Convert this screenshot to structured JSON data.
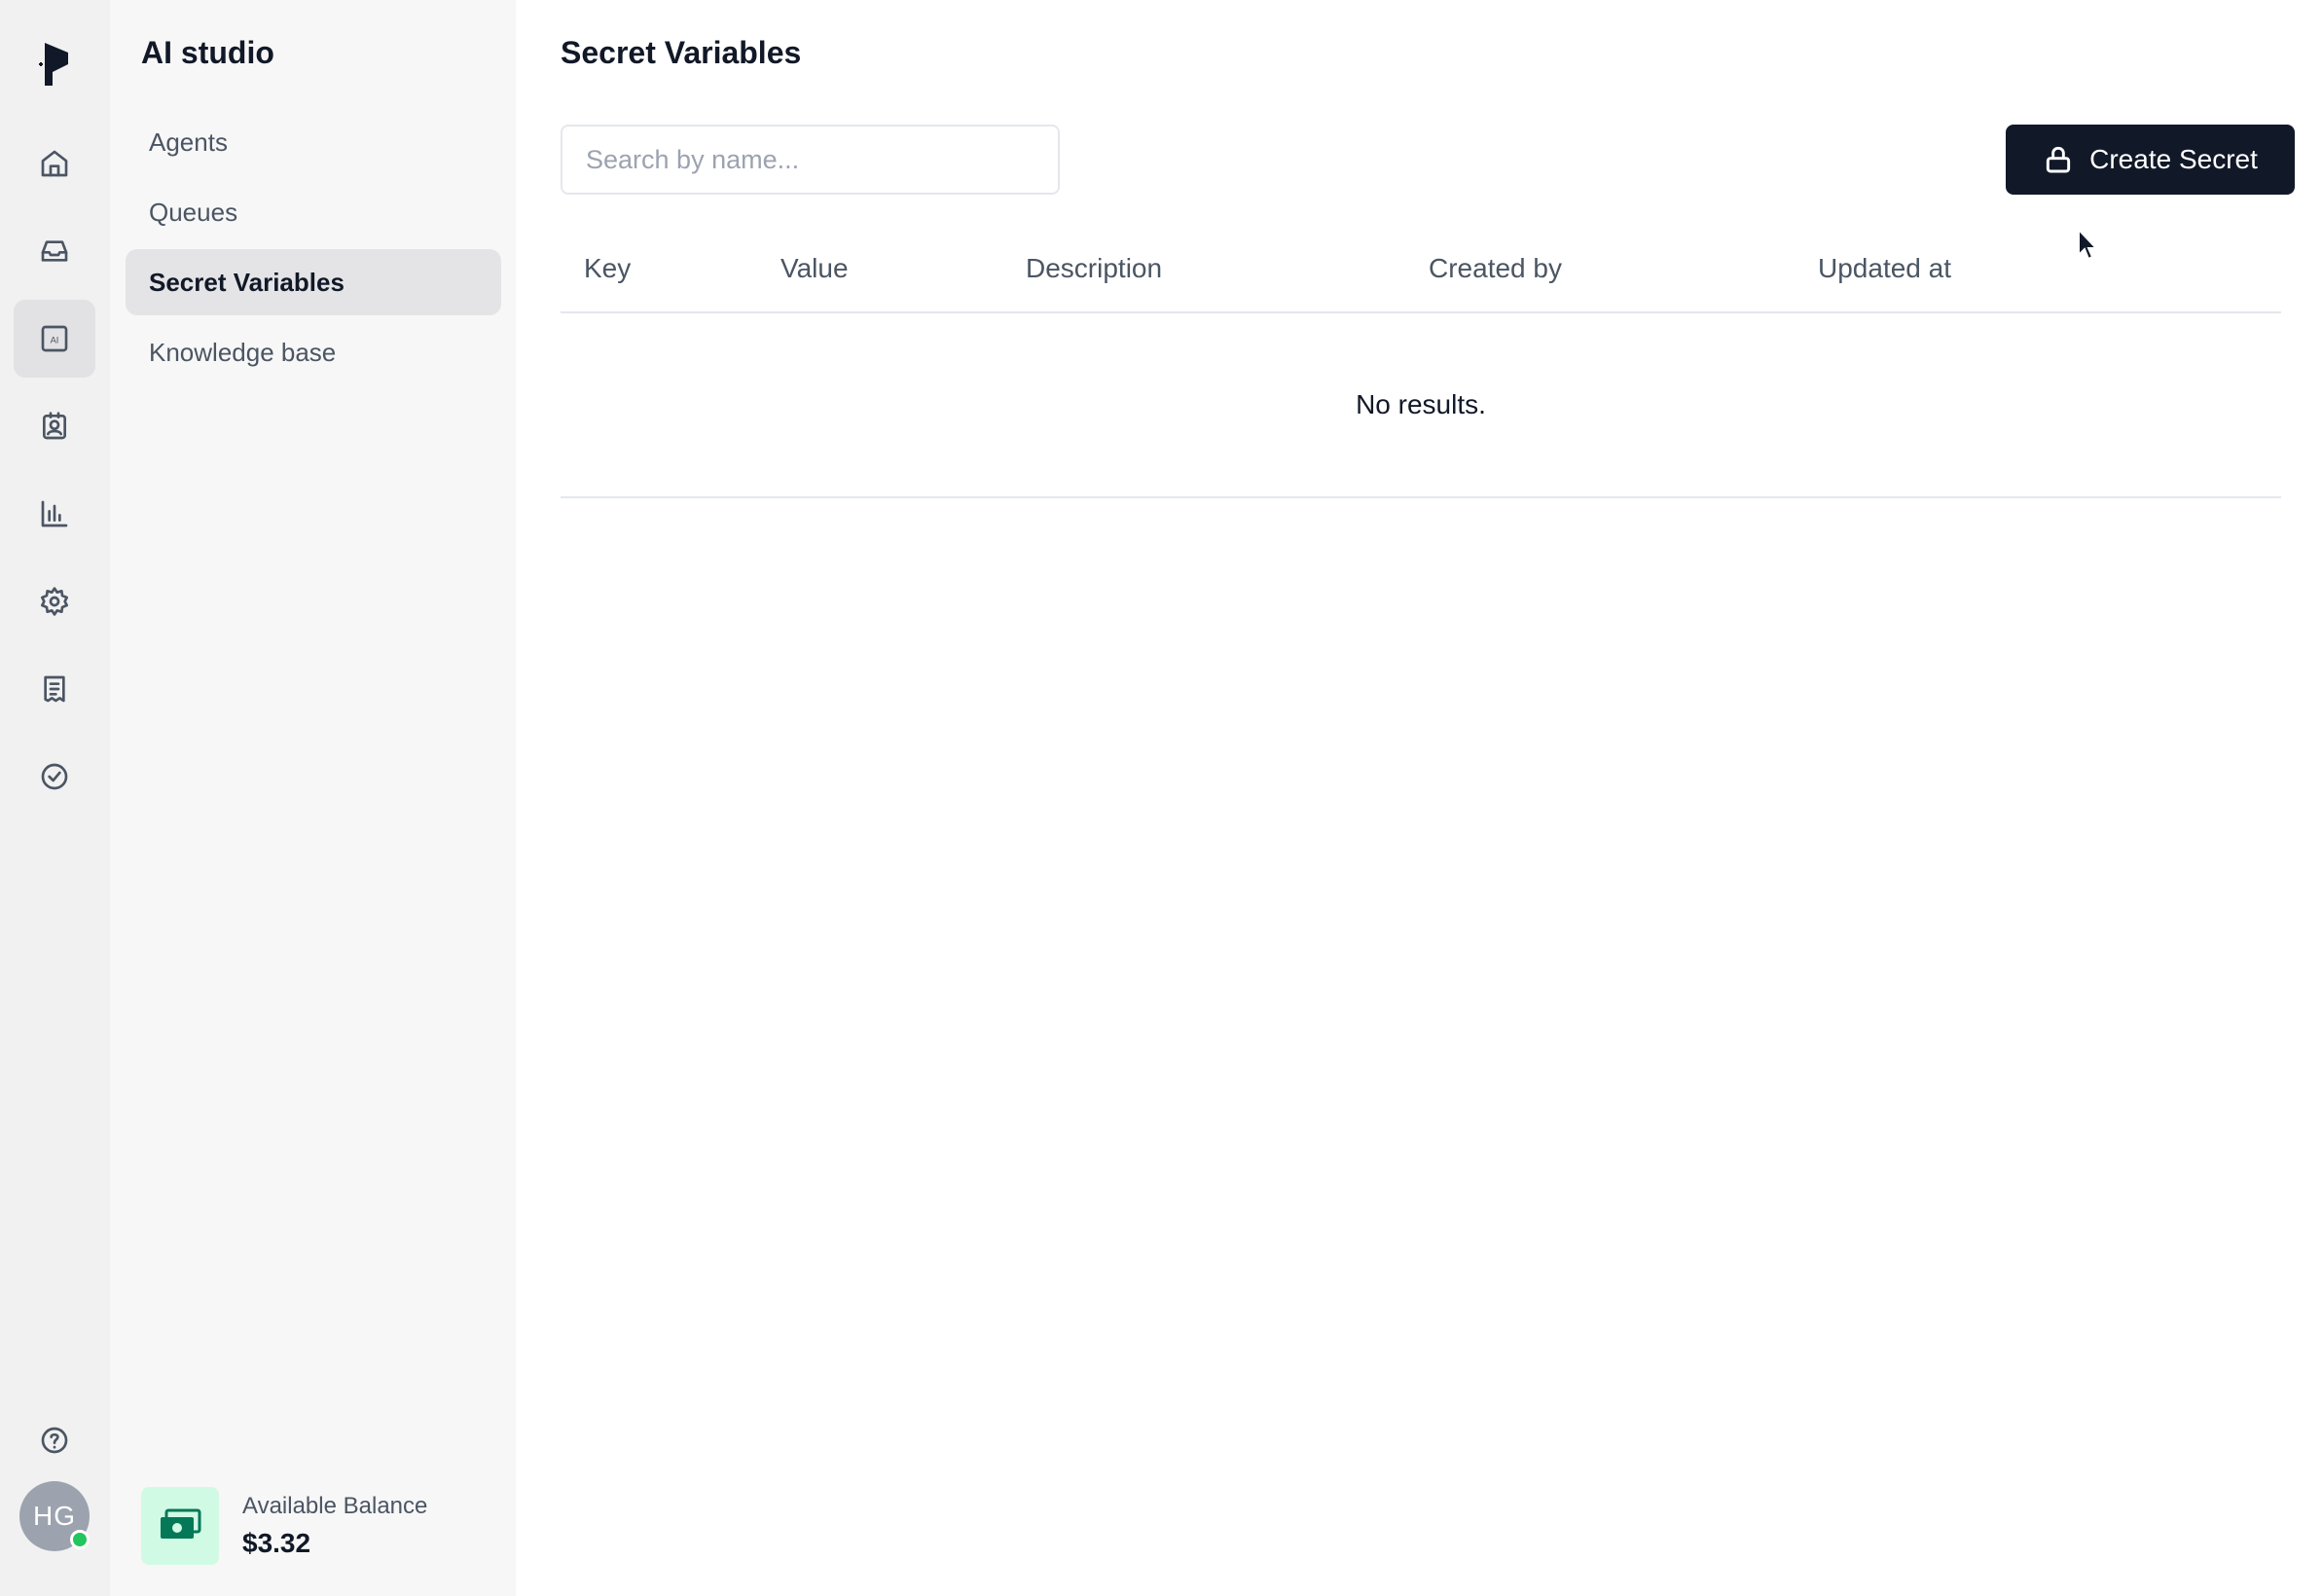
{
  "rail": {
    "icons": [
      "logo-icon",
      "home-icon",
      "inbox-icon",
      "ai-icon",
      "contacts-icon",
      "analytics-icon",
      "settings-icon",
      "billing-icon",
      "verified-icon",
      "help-icon"
    ],
    "avatar_initials": "HG"
  },
  "sidebar": {
    "title": "AI studio",
    "items": [
      {
        "label": "Agents"
      },
      {
        "label": "Queues"
      },
      {
        "label": "Secret Variables",
        "active": true
      },
      {
        "label": "Knowledge base"
      }
    ],
    "balance_label": "Available Balance",
    "balance_amount": "$3.32"
  },
  "main": {
    "title": "Secret Variables",
    "search": {
      "placeholder": "Search by name...",
      "value": ""
    },
    "create_label": "Create Secret",
    "columns": [
      "Key",
      "Value",
      "Description",
      "Created by",
      "Updated at"
    ],
    "empty_text": "No results."
  },
  "colors": {
    "primary": "#111827",
    "online": "#22c55e",
    "money": "#047857"
  }
}
